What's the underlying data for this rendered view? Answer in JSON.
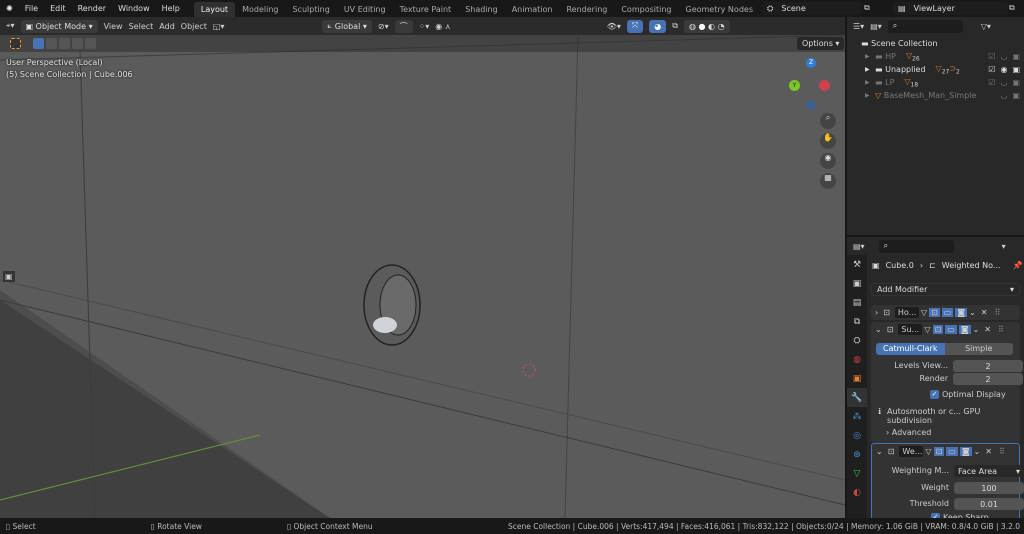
{
  "menu": [
    "File",
    "Edit",
    "Render",
    "Window",
    "Help"
  ],
  "workspaces": [
    "Layout",
    "Modeling",
    "Sculpting",
    "UV Editing",
    "Texture Paint",
    "Shading",
    "Animation",
    "Rendering",
    "Compositing",
    "Geometry Nodes",
    "Scripting"
  ],
  "active_workspace": "Layout",
  "scene": "Scene",
  "view_layer": "ViewLayer",
  "viewport_header": {
    "mode": "Object Mode",
    "menus": [
      "View",
      "Select",
      "Add",
      "Object"
    ],
    "orientation": "Global",
    "options": "Options"
  },
  "overlay": {
    "perspective": "User Perspective (Local)",
    "collection": "(5) Scene Collection | Cube.006"
  },
  "gizmo": {
    "z": "Z",
    "y": "Y"
  },
  "outliner": {
    "root": "Scene Collection",
    "items": [
      {
        "name": "HP",
        "count": "26",
        "dim": true
      },
      {
        "name": "Unapplied",
        "count": "27",
        "count2": "2",
        "dim": false
      },
      {
        "name": "LP",
        "count": "18",
        "dim": true
      },
      {
        "name": "BaseMesh_Man_Simple",
        "dim": true
      }
    ]
  },
  "properties": {
    "object": "Cube.0",
    "modifier_crumb": "Weighted No...",
    "add_modifier": "Add Modifier",
    "mod1": "Ho...",
    "mod2": "Su...",
    "mod3": "We...",
    "subsurf": {
      "tab1": "Catmull-Clark",
      "tab2": "Simple",
      "levels_label": "Levels View...",
      "levels": "2",
      "render_label": "Render",
      "render": "2",
      "optimal": "Optimal Display",
      "info": "Autosmooth or c... GPU subdivision",
      "advanced": "Advanced"
    },
    "weighted": {
      "mode_label": "Weighting M...",
      "mode": "Face Area",
      "weight_label": "Weight",
      "weight": "100",
      "threshold_label": "Threshold",
      "threshold": "0.01",
      "keep": "Keep Sharp"
    }
  },
  "status": {
    "select": "Select",
    "rotate": "Rotate View",
    "context": "Object Context Menu",
    "info": "Scene Collection | Cube.006 | Verts:417,494 | Faces:416,061 | Tris:832,122 | Objects:0/24 | Memory: 1.06 GiB | VRAM: 0.8/4.0 GiB | 3.2.0"
  },
  "colors": {
    "accent": "#4772b3",
    "x_axis": "#d0404f",
    "y_axis": "#7cc52a",
    "z_axis": "#2f7fd8"
  }
}
